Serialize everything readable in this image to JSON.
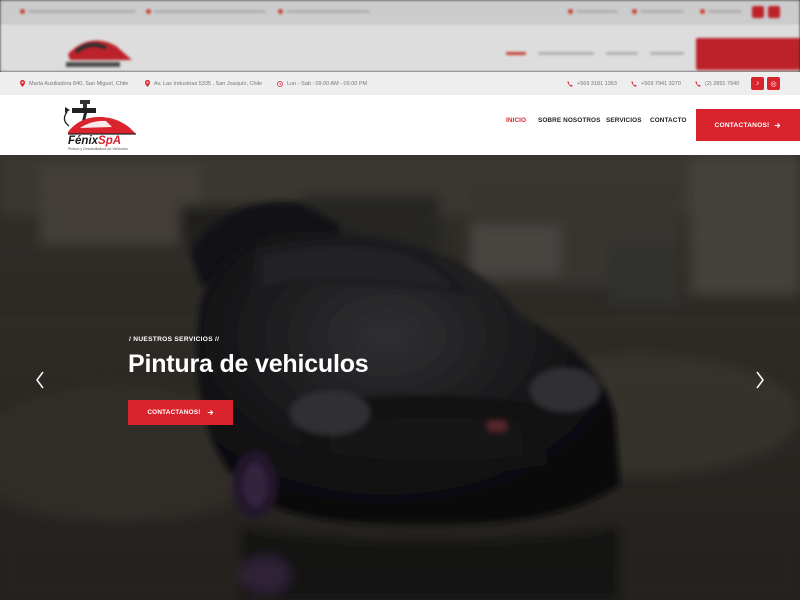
{
  "brand": {
    "name": "FénixSpA",
    "tagline": "Pintura y Desabolladura de Vehiculos",
    "accent": "#d9232d"
  },
  "infobar": {
    "addresses": [
      {
        "icon": "map-pin-icon",
        "text": "María Auxiliadora 840, San Miguel, Chile"
      },
      {
        "icon": "map-pin-icon",
        "text": "Av. Las Industrias 5335 , San Joaquín, Chile"
      }
    ],
    "hours": {
      "icon": "clock-icon",
      "text": "Lun - Sab : 09.00 AM - 09.00 PM"
    },
    "phones": [
      {
        "icon": "phone-icon",
        "text": "+569 3181 1363"
      },
      {
        "icon": "phone-icon",
        "text": "+569 7941 3270"
      },
      {
        "icon": "phone-icon",
        "text": "(2) 2891 7940"
      }
    ],
    "social": [
      {
        "icon": "tiktok-icon",
        "glyph": "♪"
      },
      {
        "icon": "instagram-icon",
        "glyph": "◎"
      }
    ]
  },
  "nav": {
    "items": [
      {
        "label": "INICIO",
        "active": true
      },
      {
        "label": "SOBRE NOSOTROS",
        "active": false
      },
      {
        "label": "SERVICIOS",
        "active": false
      },
      {
        "label": "CONTACTO",
        "active": false
      }
    ],
    "cta_label": "CONTACTANOS!"
  },
  "hero": {
    "eyebrow": "/ NUESTROS SERVICIOS //",
    "title": "Pintura de vehiculos",
    "cta_label": "CONTACTANOS!"
  }
}
